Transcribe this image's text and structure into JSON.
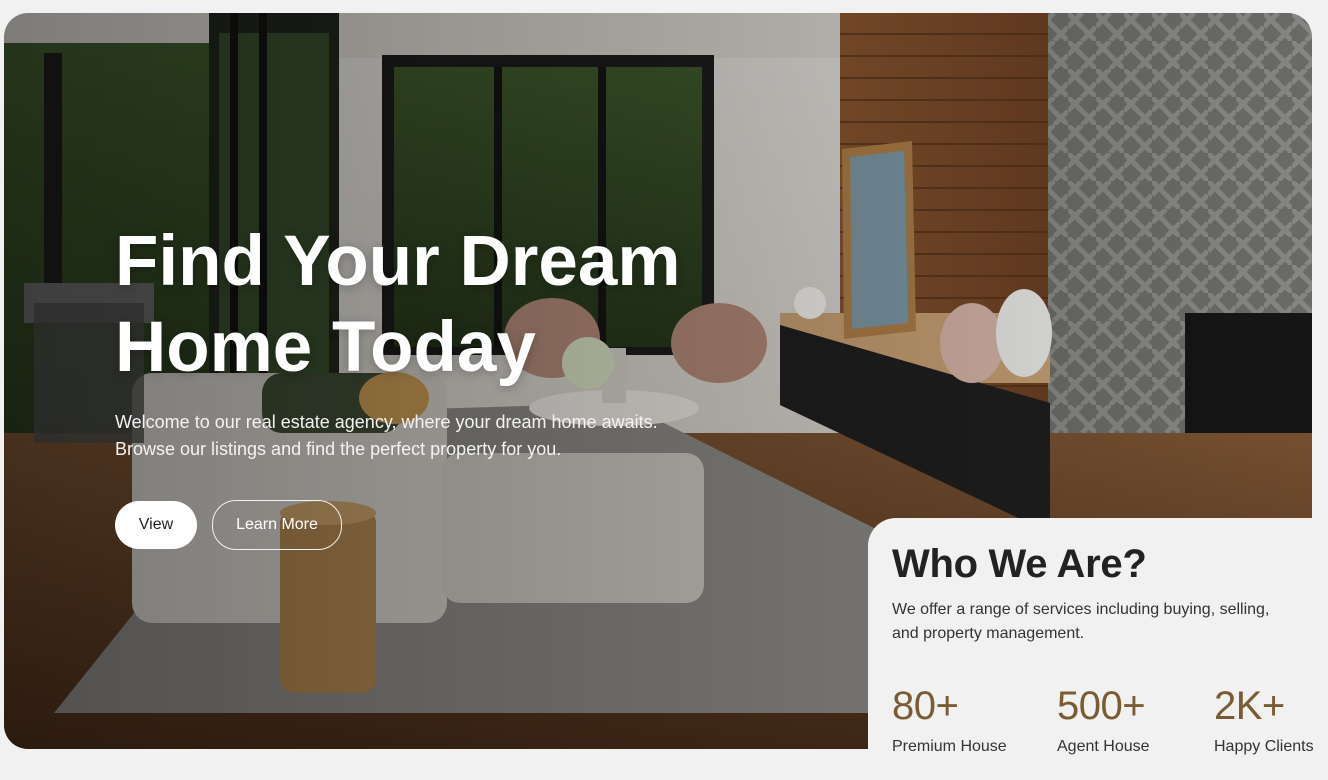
{
  "hero": {
    "title_line1": "Find Your Dream",
    "title_line2": "Home Today",
    "desc_line1": "Welcome to our real estate agency, where your dream home awaits.",
    "desc_line2": "Browse our listings and find the perfect property for you.",
    "view_label": "View",
    "learn_more_label": "Learn More"
  },
  "about": {
    "title": "Who We Are?",
    "desc_line1": "We offer a range of services including buying, selling,",
    "desc_line2": "and property management.",
    "stats": [
      {
        "value": "80+",
        "label": "Premium House"
      },
      {
        "value": "500+",
        "label": "Agent House"
      },
      {
        "value": "2K+",
        "label": "Happy Clients"
      }
    ]
  },
  "colors": {
    "accent": "#7a5c33",
    "background": "#f1f1f1",
    "text_dark": "#222222"
  }
}
